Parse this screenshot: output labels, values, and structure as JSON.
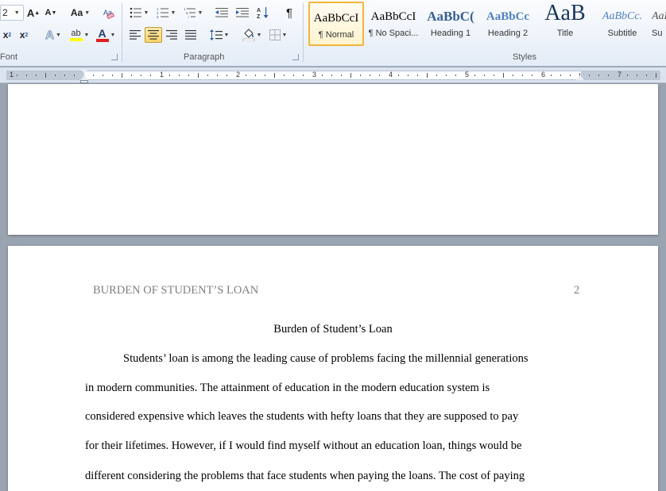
{
  "ribbon": {
    "font_group": {
      "label": "Font",
      "size_fragment": "2",
      "grow_font": "A",
      "shrink_font": "A",
      "change_case": "Aa",
      "subscript": "x",
      "superscript": "x",
      "text_effects": "A",
      "highlight": "ab",
      "font_color": "A",
      "highlight_color": "#ffff00",
      "font_color_value": "#e02020"
    },
    "paragraph_group": {
      "label": "Paragraph",
      "pilcrow": "¶"
    },
    "styles_group": {
      "label": "Styles",
      "items": [
        {
          "sample": "AaBbCcI",
          "name": "¶ Normal",
          "selected": true
        },
        {
          "sample": "AaBbCcI",
          "name": "¶ No Spaci..."
        },
        {
          "sample": "AaBbC(",
          "name": "Heading 1"
        },
        {
          "sample": "AaBbCc",
          "name": "Heading 2"
        },
        {
          "sample": "AaB",
          "name": "Title"
        },
        {
          "sample": "AaBbCc.",
          "name": "Subtitle"
        },
        {
          "sample": "AaBbCcI",
          "name": "Su"
        }
      ]
    }
  },
  "ruler": {
    "numbers": [
      "1",
      "1",
      "2",
      "3",
      "4",
      "5",
      "6",
      "7"
    ]
  },
  "document": {
    "header_left": "BURDEN OF STUDENT’S LOAN",
    "page_number": "2",
    "title": "Burden of Student’s Loan",
    "lines": [
      "Students’ loan is among the leading cause of problems facing the millennial  generations",
      "in modern communities. The attainment of education in the modern education system is",
      "considered expensive which leaves the students with hefty loans that they are supposed to pay",
      "for their lifetimes. However, if I would find myself without an education loan, things would be",
      "different considering the problems that face students when paying the loans. The cost of paying"
    ]
  }
}
